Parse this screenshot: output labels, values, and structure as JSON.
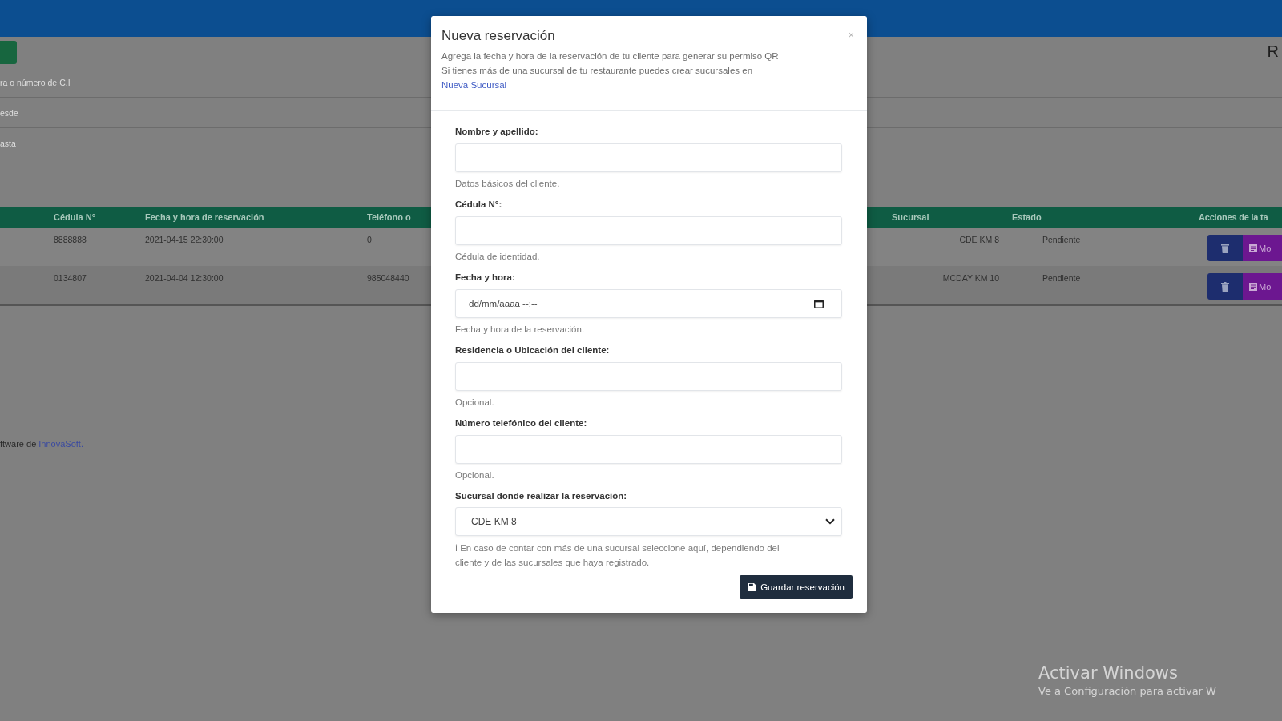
{
  "page": {
    "title": "R",
    "filters": [
      {
        "placeholder": "ra o número de C.I"
      },
      {
        "placeholder": "esde"
      },
      {
        "placeholder": "asta"
      }
    ],
    "table": {
      "columns": [
        "Cédula N°",
        "Fecha y hora de reservación",
        "Teléfono o",
        "Sucursal",
        "Estado",
        "Acciones de la ta"
      ],
      "rows": [
        {
          "cedula": "8888888",
          "fecha": "2021-04-15 22:30:00",
          "telefono": "0",
          "sucursal": "CDE KM 8",
          "estado": "Pendiente",
          "edit_label": "Mo"
        },
        {
          "cedula": "0134807",
          "fecha": "2021-04-04 12:30:00",
          "telefono": "985048440",
          "sucursal": "MCDAY KM 10",
          "estado": "Pendiente",
          "edit_label": "Mo"
        }
      ]
    },
    "footer": {
      "text": "ftware de",
      "link": "InnovaSoft."
    }
  },
  "modal": {
    "title": "Nueva reservación",
    "close": "×",
    "description_lines": [
      "Agrega la fecha y hora de la reservación de tu cliente para generar su permiso QR",
      "Si tienes más de una sucursal de tu restaurante puedes crear sucursales en"
    ],
    "description_link": "Nueva Sucursal",
    "fields": [
      {
        "kind": "text",
        "label": "Nombre y apellido:",
        "help": "Datos básicos del cliente."
      },
      {
        "kind": "text",
        "label": "Cédula N°:",
        "help": "Cédula de identidad."
      },
      {
        "kind": "datetime",
        "label": "Fecha y hora:",
        "placeholder": "dd/mm/aaaa --:--",
        "help": "Fecha y hora de la reservación."
      },
      {
        "kind": "text",
        "label": "Residencia o Ubicación del cliente:",
        "help": "Opcional."
      },
      {
        "kind": "text",
        "label": "Número telefónico del cliente:",
        "help": "Opcional."
      },
      {
        "kind": "select",
        "label": "Sucursal donde realizar la reservación:",
        "value": "CDE KM 8",
        "help": "ℹ En caso de contar con más de una sucursal seleccione aquí, dependiendo del cliente y de las sucursales que haya registrado."
      }
    ],
    "submit": "Guardar reservación"
  },
  "os_notice": {
    "title": "Activar Windows",
    "text": "Ve a Configuración para activar W"
  }
}
